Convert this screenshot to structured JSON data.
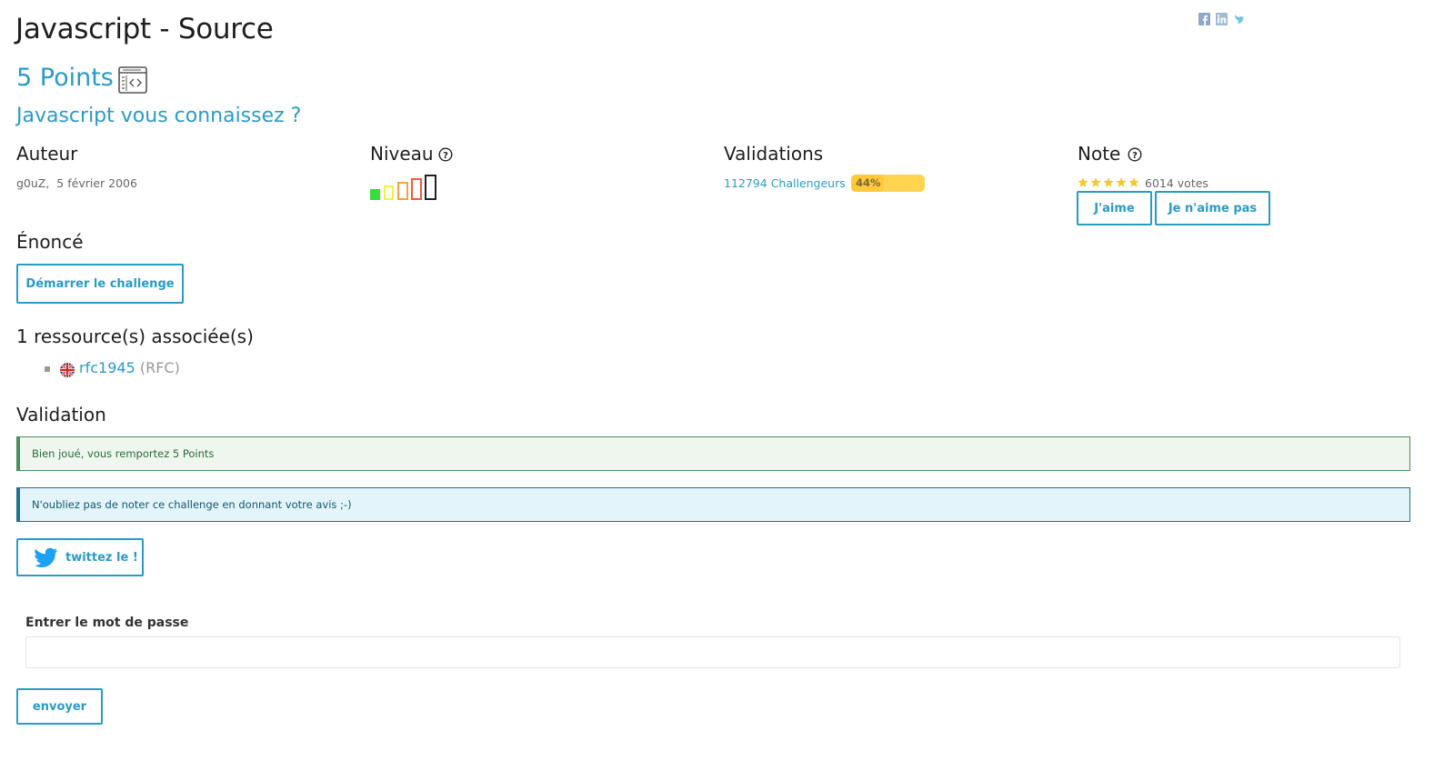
{
  "page": {
    "title": "Javascript - Source",
    "points": "5 Points",
    "subtitle": "Javascript vous connaissez ?"
  },
  "social": {
    "icons": [
      "facebook-icon",
      "linkedin-icon",
      "twitter-icon"
    ]
  },
  "meta": {
    "author": {
      "heading": "Auteur",
      "name": "g0uZ",
      "date": "5 février 2006"
    },
    "level": {
      "heading": "Niveau",
      "current": 1,
      "max": 5,
      "colors": [
        "#3adb3a",
        "#f4f43a",
        "#f4a43a",
        "#f45a3a",
        "#222222"
      ]
    },
    "validations": {
      "heading": "Validations",
      "count_label": "112794 Challengeurs",
      "percent_label": "44%",
      "percent_value": 44
    },
    "note": {
      "heading": "Note",
      "stars": 5,
      "votes_label": "6014 votes",
      "like_label": "J'aime",
      "dislike_label": "Je n'aime pas"
    }
  },
  "statement": {
    "heading": "Énoncé",
    "start_label": "Démarrer le challenge"
  },
  "resources": {
    "heading": "1 ressource(s) associée(s)",
    "items": [
      {
        "name": "rfc1945",
        "type": "(RFC)",
        "flag": "uk-flag-icon"
      }
    ]
  },
  "validation": {
    "heading": "Validation",
    "success_message": "Bien joué, vous remportez 5 Points",
    "info_message": "N'oubliez pas de noter ce challenge en donnant votre avis ;-)",
    "tweet_label": "twittez le !",
    "password_label": "Entrer le mot de passe",
    "password_value": "",
    "submit_label": "envoyer"
  },
  "colors": {
    "accent": "#2a9bc6",
    "progress": "#ffc93a",
    "star": "#f2c830",
    "success_border": "#4a8c5c",
    "info_border": "#1d7191",
    "twitter": "#1da1f2"
  }
}
